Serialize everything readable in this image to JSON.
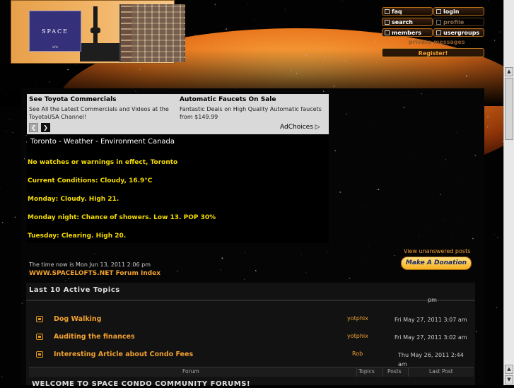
{
  "logo": {
    "text": "SPACE",
    "subtitle": "lofts"
  },
  "header_nav": {
    "faq": "faq",
    "login": "login",
    "search": "search",
    "profile": "profile",
    "members": "members",
    "usergroups": "usergroups",
    "private_messages": "private messages",
    "register": "Register!"
  },
  "ads": [
    {
      "title": "See Toyota Commercials",
      "description": "See All the Latest Commercials and Videos at the ToyotaUSA Channel!"
    },
    {
      "title": "Automatic Faucets On Sale",
      "description": "Fantastic Deals on High Quality Automatic faucets from $149.99"
    }
  ],
  "ad_nav": {
    "prev": "❮",
    "next": "❯",
    "adchoices": "AdChoices ▷"
  },
  "weather": {
    "title": "Toronto - Weather - Environment Canada",
    "lines": [
      "No watches or warnings in effect, Toronto",
      "Current Conditions: Cloudy, 16.9°C",
      "Monday: Cloudy. High 21.",
      "Monday night: Chance of showers. Low 13. POP 30%",
      "Tuesday: Clearing. High 20."
    ]
  },
  "forum": {
    "time_now": "The time now is Mon Jun 13, 2011 2:06 pm",
    "index_link": "WWW.SPACELOFTS.NET Forum Index",
    "view_unanswered": "View unanswered posts",
    "donate": "Make A Donation"
  },
  "active_topics": {
    "title": "Last 10 Active Topics",
    "partial_pm": "pm",
    "topics": [
      {
        "title": "Dog Walking",
        "user": "yotphix",
        "date": "Fri May 27, 2011 3:07 am"
      },
      {
        "title": "Auditing the finances",
        "user": "yotphix",
        "date": "Fri May 27, 2011 3:02 am"
      },
      {
        "title": "Interesting Article about Condo Fees",
        "user": "Rob",
        "date": "Thu May 26, 2011 2:44 am"
      }
    ]
  },
  "forum_table": {
    "headers": {
      "forum": "Forum",
      "topics": "Topics",
      "posts": "Posts",
      "last_post": "Last Post"
    },
    "welcome": "WELCOME TO SPACE CONDO COMMUNITY FORUMS!"
  },
  "scrollbar": {
    "up": "▲",
    "down": "▼"
  },
  "colors": {
    "accent": "#f0a030",
    "weather_text": "#f6dc00",
    "ad_bg": "#d9d9d9"
  }
}
